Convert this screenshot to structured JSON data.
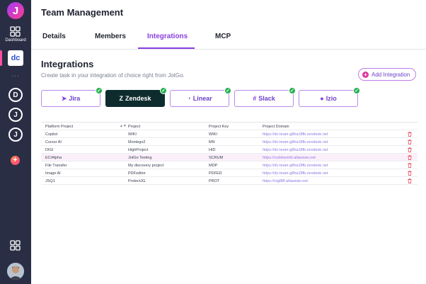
{
  "sidebar": {
    "logo_letter": "J",
    "dashboard_label": "Dashboard",
    "active_workspace": "dc",
    "more": "...",
    "workspaces": [
      "D",
      "J",
      "J"
    ],
    "add_label": "+",
    "icons": [
      "dashboard-icon",
      "apps-icon"
    ]
  },
  "header": {
    "title": "Team Management"
  },
  "tabs": [
    {
      "label": "Details"
    },
    {
      "label": "Members"
    },
    {
      "label": "Integrations",
      "active": true
    },
    {
      "label": "MCP"
    }
  ],
  "integrations": {
    "title": "Integrations",
    "subtitle": "Create task in your integration of choice right from JotGo.",
    "add_button": "Add Integration",
    "cards": [
      {
        "label": "Jira",
        "icon": "jira-icon",
        "connected": true
      },
      {
        "label": "Zendesk",
        "icon": "zendesk-icon",
        "connected": true,
        "selected": true
      },
      {
        "label": "Linear",
        "icon": "linear-icon",
        "connected": true
      },
      {
        "label": "Slack",
        "icon": "slack-icon",
        "connected": true
      },
      {
        "label": "Izio",
        "icon": "izio-icon",
        "connected": true
      }
    ],
    "check_glyph": "✓"
  },
  "table": {
    "headers": [
      "Platform Project",
      "Project",
      "Project Key",
      "Project Domain"
    ],
    "rows": [
      {
        "platform": "Copilot",
        "project": "WIKI",
        "key": "WIKI",
        "domain": "https://dc-team-g8ha18fb.zendesk.net"
      },
      {
        "platform": "Cursor AI",
        "project": "Montego2",
        "key": "MN",
        "domain": "https://dc-team-g8ha18fb.zendesk.net"
      },
      {
        "platform": "DIGI",
        "project": "HighProject",
        "key": "HID",
        "domain": "https://dc-team-g8ha18fb.zendesk.net"
      },
      {
        "platform": "EC/Alpha",
        "project": "JotGo Testing",
        "key": "SCRUM",
        "domain": "https://cubikworld.atlassian.net"
      },
      {
        "platform": "File Transfer",
        "project": "My discovery project",
        "key": "MDP",
        "domain": "https://dc-team-g8ha18fb.zendesk.net"
      },
      {
        "platform": "Image AI",
        "project": "PDFeditor",
        "key": "PDFED",
        "domain": "https://dc-team-g8ha18fb.zendesk.net"
      },
      {
        "platform": "JSQ1",
        "project": "ProtectJG",
        "key": "PROT",
        "domain": "https://ctg88f.atlassian.net"
      }
    ]
  },
  "colors": {
    "sidebar": "#2a2e45",
    "accent": "#8a3fe0",
    "selected_card": "#0e2b2e",
    "check": "#22b14c",
    "delete": "#e0344a"
  }
}
